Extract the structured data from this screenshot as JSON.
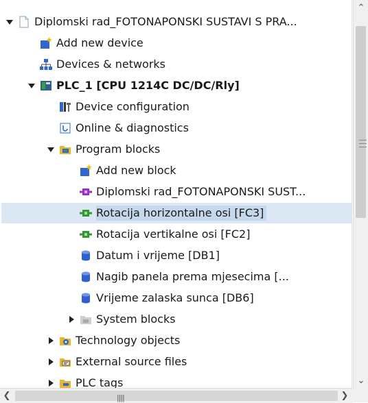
{
  "tree": {
    "items": [
      {
        "label": "Diplomski rad_FOTONAPONSKI SUSTAVI S PRA...",
        "icon": "project-icon",
        "caret": "down",
        "level": 0
      },
      {
        "label": "Add new device",
        "icon": "add-device-icon",
        "caret": "none",
        "level": 1
      },
      {
        "label": "Devices & networks",
        "icon": "network-icon",
        "caret": "none",
        "level": 1
      },
      {
        "label": "PLC_1 [CPU 1214C DC/DC/Rly]",
        "icon": "plc-icon",
        "caret": "down",
        "level": 1
      },
      {
        "label": "Device configuration",
        "icon": "device-config-icon",
        "caret": "none",
        "level": 2
      },
      {
        "label": "Online & diagnostics",
        "icon": "diagnostics-icon",
        "caret": "none",
        "level": 2
      },
      {
        "label": "Program blocks",
        "icon": "folder-blocks-icon",
        "caret": "down",
        "level": 2
      },
      {
        "label": "Add new block",
        "icon": "add-block-icon",
        "caret": "none",
        "level": 3
      },
      {
        "label": "Diplomski rad_FOTONAPONSKI SUST...",
        "icon": "ob-block-icon",
        "caret": "none",
        "level": 3
      },
      {
        "label": "Rotacija horizontalne osi [FC3]",
        "icon": "fc-block-icon",
        "caret": "none",
        "level": 3
      },
      {
        "label": "Rotacija vertikalne osi [FC2]",
        "icon": "fc-block-icon",
        "caret": "none",
        "level": 3
      },
      {
        "label": "Datum i vrijeme [DB1]",
        "icon": "db-block-icon",
        "caret": "none",
        "level": 3
      },
      {
        "label": "Nagib panela prema mjesecima [...",
        "icon": "db-block-icon",
        "caret": "none",
        "level": 3
      },
      {
        "label": "Vrijeme zalaska sunca [DB6]",
        "icon": "db-block-icon",
        "caret": "none",
        "level": 3
      },
      {
        "label": "System blocks",
        "icon": "system-folder-icon",
        "caret": "right",
        "level": 3
      },
      {
        "label": "Technology objects",
        "icon": "technology-icon",
        "caret": "right",
        "level": 2
      },
      {
        "label": "External source files",
        "icon": "source-files-icon",
        "caret": "right",
        "level": 2
      },
      {
        "label": "PLC tags",
        "icon": "tags-icon",
        "caret": "right",
        "level": 2
      }
    ],
    "selected_label": "Rotacija horizontalne osi [FC3]",
    "bold_label": "PLC_1 [CPU 1214C DC/DC/Rly]"
  },
  "scrollbars": {
    "vertical_up_icon": "chevron-up-icon",
    "vertical_down_icon": "chevron-down-icon",
    "horizontal_left_icon": "chevron-left-icon",
    "horizontal_right_icon": "chevron-right-icon"
  },
  "colors": {
    "selection": "#c6d9ec",
    "ob_block": "#9b30c8",
    "fc_block": "#2e9a2e",
    "db_block": "#2f5fd0",
    "folder": "#e8b530"
  }
}
